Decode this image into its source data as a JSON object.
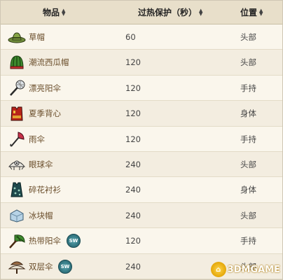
{
  "table": {
    "headers": {
      "item": "物品",
      "protection": "过热保护（秒）",
      "position": "位置"
    },
    "rows": [
      {
        "icon": "straw-hat-icon",
        "name": "草帽",
        "protection": "60",
        "position": "头部",
        "badge": ""
      },
      {
        "icon": "watermelon-hat-icon",
        "name": "潮流西瓜帽",
        "protection": "120",
        "position": "头部",
        "badge": ""
      },
      {
        "icon": "pretty-parasol-icon",
        "name": "漂亮阳伞",
        "protection": "120",
        "position": "手持",
        "badge": ""
      },
      {
        "icon": "summer-vest-icon",
        "name": "夏季背心",
        "protection": "120",
        "position": "身体",
        "badge": ""
      },
      {
        "icon": "umbrella-icon",
        "name": "雨伞",
        "protection": "120",
        "position": "手持",
        "badge": ""
      },
      {
        "icon": "eyebrella-icon",
        "name": "眼球伞",
        "protection": "240",
        "position": "头部",
        "badge": ""
      },
      {
        "icon": "floral-shirt-icon",
        "name": "碎花衬衫",
        "protection": "240",
        "position": "身体",
        "badge": ""
      },
      {
        "icon": "ice-cube-hat-icon",
        "name": "冰块帽",
        "protection": "240",
        "position": "头部",
        "badge": ""
      },
      {
        "icon": "tropical-parasol-icon",
        "name": "热带阳伞",
        "protection": "120",
        "position": "手持",
        "badge": "SW"
      },
      {
        "icon": "double-umbrellahat-icon",
        "name": "双层伞",
        "protection": "240",
        "position": "头部",
        "badge": "SW"
      }
    ]
  },
  "watermark": {
    "brand": "3DMGAME"
  }
}
